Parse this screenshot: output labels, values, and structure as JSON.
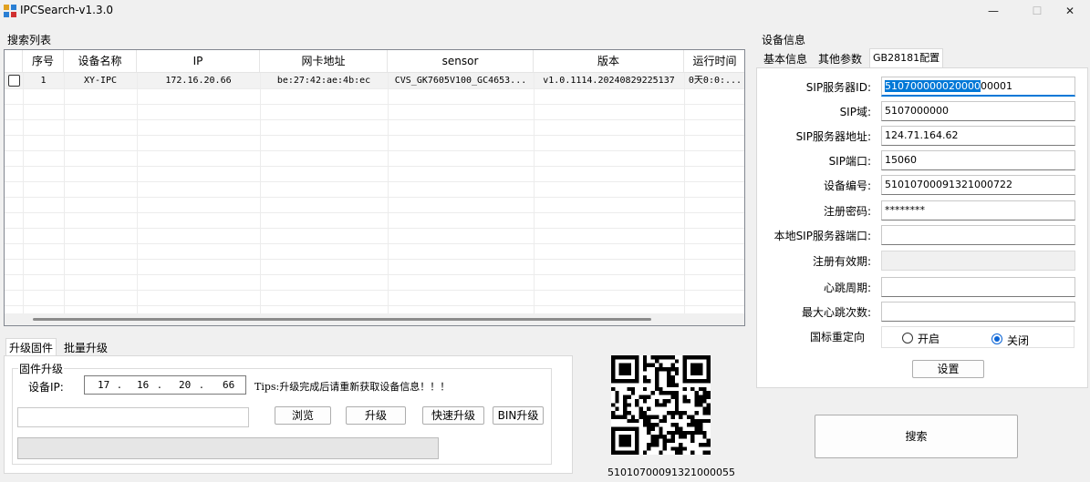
{
  "window": {
    "title": "IPCSearch-v1.3.0",
    "minimize_glyph": "—",
    "maximize_glyph": "☐",
    "close_glyph": "✕"
  },
  "search_list": {
    "label": "搜索列表",
    "columns": [
      "序号",
      "设备名称",
      "IP",
      "网卡地址",
      "sensor",
      "版本",
      "运行时间"
    ],
    "rows": [
      {
        "checked": false,
        "cells": [
          "1",
          "XY-IPC",
          "172.16.20.66",
          "be:27:42:ae:4b:ec",
          "CVS_GK7605V100_GC4653...",
          "v1.0.1114.20240829225137",
          "0天0:0:..."
        ]
      }
    ]
  },
  "firmware": {
    "tabs": [
      "升级固件",
      "批量升级"
    ],
    "group_label": "固件升级",
    "device_ip_label": "设备IP:",
    "ip_octets": [
      "17",
      "16",
      "20",
      "66"
    ],
    "tips": "Tips:升级完成后请重新获取设备信息！！！",
    "path_value": "",
    "buttons": {
      "browse": "浏览",
      "upgrade": "升级",
      "fast_upgrade": "快速升级",
      "bin_upgrade": "BIN升级"
    },
    "progress": 0
  },
  "qr": {
    "caption": "51010700091321000055"
  },
  "device_info": {
    "label": "设备信息",
    "tabs": [
      "基本信息",
      "其他参数",
      "GB28181配置"
    ],
    "fields": [
      {
        "label": "SIP服务器ID:",
        "value_selected": "510700000020000",
        "value_rest": "00001"
      },
      {
        "label": "SIP域:",
        "value": "5107000000"
      },
      {
        "label": "SIP服务器地址:",
        "value": "124.71.164.62"
      },
      {
        "label": "SIP端口:",
        "value": "15060"
      },
      {
        "label": "设备编号:",
        "value": "51010700091321000722"
      },
      {
        "label": "注册密码:",
        "value": "********"
      },
      {
        "label": "本地SIP服务器端口:",
        "value": ""
      },
      {
        "label": "注册有效期:",
        "value": ""
      },
      {
        "label": "心跳周期:",
        "value": ""
      },
      {
        "label": "最大心跳次数:",
        "value": ""
      }
    ],
    "redirect_label": "国标重定向",
    "redirect_on": "开启",
    "redirect_off": "关闭",
    "redirect_value": "off",
    "set_button": "设置"
  },
  "search_button": "搜索",
  "colors": {
    "selection": "#0078d7",
    "accent_radio": "#0a64d6"
  }
}
